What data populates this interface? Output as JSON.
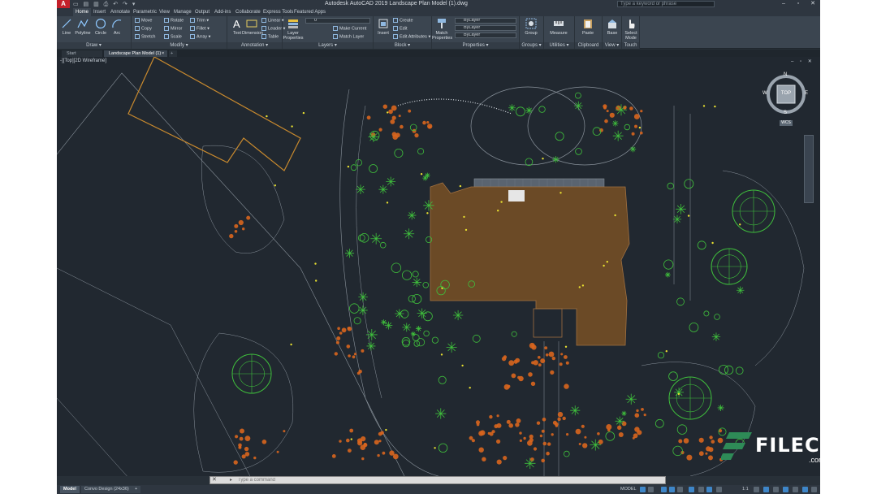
{
  "app": {
    "logo_letter": "A",
    "title": "Autodesk AutoCAD 2019   Landscape Plan Model (1).dwg",
    "search_placeholder": "Type a keyword or phrase",
    "qat_glyphs": "▭ ▤ ▥ ⎙ ↶ ↷ ▾"
  },
  "window_controls": {
    "minimize": "–",
    "restore": "▫",
    "close": "✕"
  },
  "ribbon_tabs": [
    "Home",
    "Insert",
    "Annotate",
    "Parametric",
    "View",
    "Manage",
    "Output",
    "Add-ins",
    "Collaborate",
    "Express Tools",
    "Featured Apps"
  ],
  "ribbon": {
    "draw": {
      "label": "Draw ▾",
      "line": "Line",
      "polyline": "Polyline",
      "circle": "Circle",
      "arc": "Arc"
    },
    "modify": {
      "label": "Modify ▾",
      "move": "Move",
      "rotate": "Rotate",
      "trim": "Trim ▾",
      "copy": "Copy",
      "mirror": "Mirror",
      "fillet": "Fillet ▾",
      "stretch": "Stretch",
      "scale": "Scale",
      "array": "Array ▾"
    },
    "annotation": {
      "label": "Annotation ▾",
      "text": "Text",
      "dimension": "Dimension",
      "linear": "Linear ▾",
      "leader": "Leader ▾",
      "table": "Table"
    },
    "layers": {
      "label": "Layers ▾",
      "layer_properties": "Layer Properties",
      "layer_value": "0",
      "make_current": "Make Current",
      "match_layer": "Match Layer"
    },
    "block": {
      "label": "Block ▾",
      "insert": "Insert",
      "create": "Create",
      "edit": "Edit",
      "edit_attributes": "Edit Attributes ▾"
    },
    "properties": {
      "label": "Properties ▾",
      "match": "Match Properties",
      "color": "ByLayer",
      "linetype": "ByLayer",
      "lineweight": "ByLayer"
    },
    "groups": {
      "label": "Groups ▾",
      "group": "Group"
    },
    "utilities": {
      "label": "Utilities ▾",
      "measure": "Measure"
    },
    "clipboard": {
      "label": "Clipboard",
      "paste": "Paste"
    },
    "view": {
      "label": "View ▾",
      "base": "Base"
    },
    "touch": {
      "label": "Touch",
      "select_mode": "Select Mode"
    }
  },
  "doc_tabs": {
    "start": "Start",
    "active": "Landscape Plan Model (1)*",
    "close": "×",
    "add": "+"
  },
  "viewport": {
    "label": "-][Top][2D Wireframe]",
    "controls": "– ▫ ✕"
  },
  "viewcube": {
    "top": "TOP",
    "n": "N",
    "s": "S",
    "e": "E",
    "w": "W",
    "wcs": "WCS"
  },
  "command": {
    "placeholder": "Type a command",
    "close": "✕",
    "prompt": "▸"
  },
  "layout_tabs": [
    "Model",
    "Convo Design (24x36)",
    "+"
  ],
  "status": {
    "model": "MODEL",
    "scale": "1:1"
  },
  "watermark": {
    "text": "FILECR",
    "sub": ".com"
  },
  "colors": {
    "building": "#6b4a26",
    "tree_red": "#d8651e",
    "tree_green": "#3fbf3c",
    "outline_orange": "#c98a2e",
    "line_grey": "#8a939c",
    "yellow_dot": "#e8e030",
    "watermark_green": "#2e8b57"
  }
}
